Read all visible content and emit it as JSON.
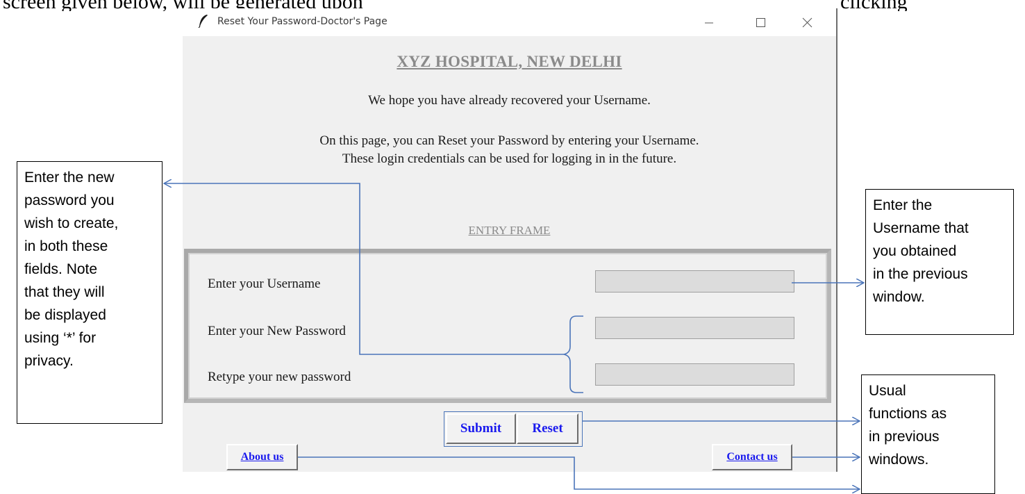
{
  "document": {
    "top_text_left": "screen given below, will be generated upon",
    "top_text_right": "clicking"
  },
  "window": {
    "title": "Reset Your Password-Doctor's Page",
    "hospital_name": "XYZ HOSPITAL, NEW DELHI",
    "intro_line_1": "We hope you have already recovered your Username.",
    "intro_line_2": "On this page, you can Reset your Password by entering your Username.",
    "intro_line_3": "These login credentials can be used for logging in in the future.",
    "entry_frame_title": "ENTRY FRAME",
    "labels": {
      "username": "Enter your Username",
      "new_password": "Enter your New Password",
      "retype_password": "Retype your new password"
    },
    "fields": {
      "username_value": "",
      "new_password_value": "",
      "retype_password_value": ""
    },
    "buttons": {
      "submit": "Submit",
      "reset": "Reset",
      "about": "About us",
      "contact": "Contact us"
    },
    "controls": [
      "minimize-icon",
      "maximize-icon",
      "close-icon"
    ]
  },
  "callouts": {
    "left": [
      "Enter the new",
      "password you",
      "wish to create,",
      "in both these",
      "fields. Note",
      "that they will",
      "be displayed",
      "using ‘*’ for",
      "privacy."
    ],
    "right": [
      "Enter the",
      "Username that",
      "you obtained",
      "in the previous",
      "window."
    ],
    "bottom": [
      "Usual",
      "functions as",
      "in previous",
      "windows."
    ]
  },
  "colors": {
    "window_bg": "#f0f0f0",
    "link_blue": "#1a1aee",
    "arrow_blue": "#4a74b9"
  }
}
